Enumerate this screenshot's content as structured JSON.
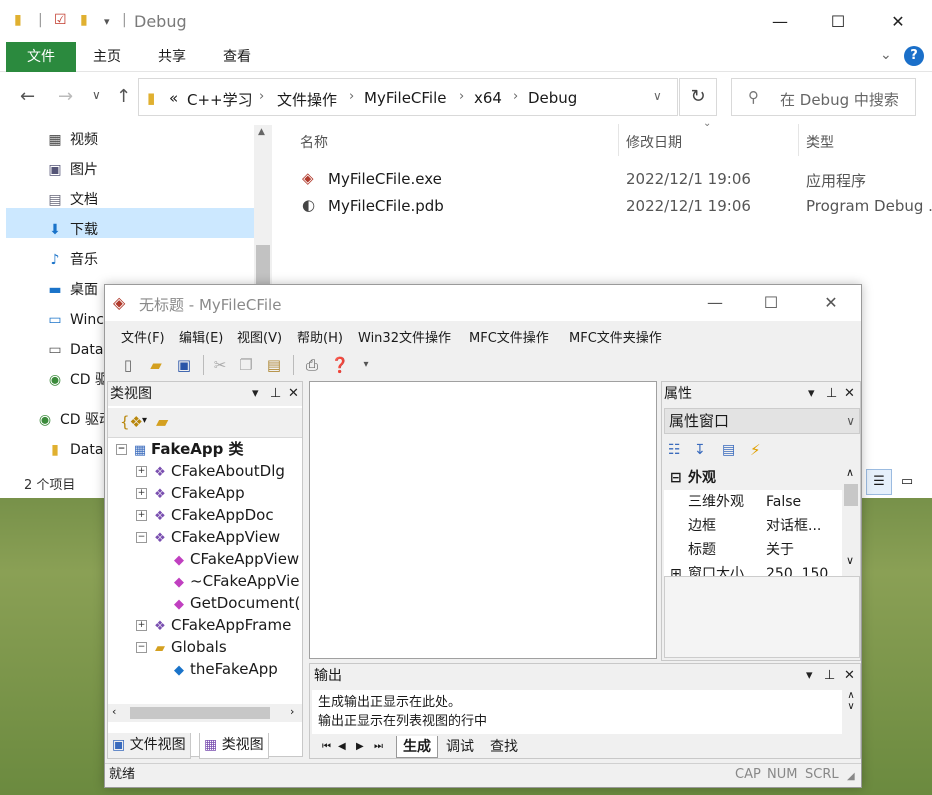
{
  "explorer": {
    "title": "Debug",
    "ribbon_tabs": [
      "文件",
      "主页",
      "共享",
      "查看"
    ],
    "breadcrumb": [
      "C++学习",
      "文件操作",
      "MyFileCFile",
      "x64",
      "Debug"
    ],
    "breadcrumb_lead": "«",
    "search_placeholder": "在 Debug 中搜索",
    "nav_items": [
      {
        "label": "视频",
        "icon": "video-icon"
      },
      {
        "label": "图片",
        "icon": "picture-icon"
      },
      {
        "label": "文档",
        "icon": "document-icon"
      },
      {
        "label": "下载",
        "icon": "download-icon"
      },
      {
        "label": "音乐",
        "icon": "music-icon"
      },
      {
        "label": "桌面",
        "icon": "desktop-icon"
      },
      {
        "label": "Winc",
        "icon": "drive-icon"
      },
      {
        "label": "Data",
        "icon": "drive-icon"
      },
      {
        "label": "CD 驱",
        "icon": "cd-drive-icon"
      },
      {
        "label": "CD 驱动",
        "icon": "cd-drive-icon"
      },
      {
        "label": "Data",
        "icon": "folder-icon"
      }
    ],
    "columns": {
      "name": "名称",
      "date": "修改日期",
      "type": "类型"
    },
    "files": [
      {
        "name": "MyFileCFile.exe",
        "date": "2022/12/1 19:06",
        "type": "应用程序"
      },
      {
        "name": "MyFileCFile.pdb",
        "date": "2022/12/1 19:06",
        "type": "Program Debug ..."
      }
    ],
    "status": "2 个项目"
  },
  "mfc": {
    "title": "无标题 - MyFileCFile",
    "menu": [
      "文件(F)",
      "编辑(E)",
      "视图(V)",
      "帮助(H)",
      "Win32文件操作",
      "MFC文件操作",
      "MFC文件夹操作"
    ],
    "classview": {
      "title": "类视图",
      "tree": [
        {
          "label": "FakeApp 类",
          "bold": true
        },
        {
          "label": "CFakeAboutDlg"
        },
        {
          "label": "CFakeApp"
        },
        {
          "label": "CFakeAppDoc"
        },
        {
          "label": "CFakeAppView"
        },
        {
          "label": "CFakeAppView"
        },
        {
          "label": "~CFakeAppVie"
        },
        {
          "label": "GetDocument("
        },
        {
          "label": "CFakeAppFrame"
        },
        {
          "label": "Globals"
        },
        {
          "label": "theFakeApp"
        }
      ],
      "tabs": [
        "文件视图",
        "类视图"
      ]
    },
    "properties": {
      "title": "属性",
      "combo": "属性窗口",
      "group": "外观",
      "rows": [
        {
          "key": "三维外观",
          "value": "False"
        },
        {
          "key": "边框",
          "value": "对话框..."
        },
        {
          "key": "标题",
          "value": "关于"
        },
        {
          "key": "窗口大小",
          "value": "250, 150"
        }
      ]
    },
    "output": {
      "title": "输出",
      "lines": [
        "生成输出正显示在此处。",
        "输出正显示在列表视图的行中"
      ],
      "tabs": [
        "生成",
        "调试",
        "查找"
      ]
    },
    "status": {
      "ready": "就绪",
      "cap": "CAP",
      "num": "NUM",
      "scrl": "SCRL"
    }
  }
}
